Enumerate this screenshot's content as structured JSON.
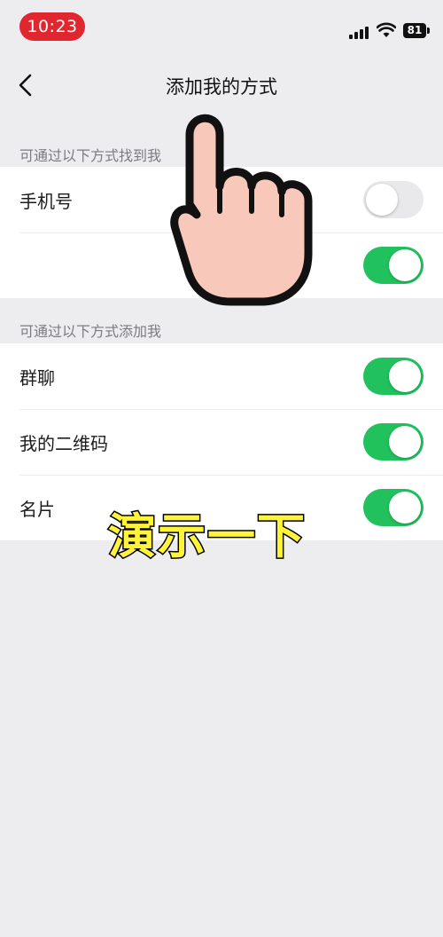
{
  "status_bar": {
    "time": "10:23",
    "battery": "81"
  },
  "nav": {
    "title": "添加我的方式"
  },
  "section_find": {
    "header": "可通过以下方式找到我",
    "items": [
      {
        "label": "手机号",
        "enabled": false
      },
      {
        "label": "",
        "enabled": true
      }
    ]
  },
  "section_add": {
    "header": "可通过以下方式添加我",
    "items": [
      {
        "label": "群聊",
        "enabled": true
      },
      {
        "label": "我的二维码",
        "enabled": true
      },
      {
        "label": "名片",
        "enabled": true
      }
    ]
  },
  "overlay": {
    "caption": "演示一下"
  },
  "colors": {
    "toggle_on": "#21c25e",
    "toggle_off": "#e9e9eb",
    "time_pill": "#e0262e",
    "caption": "#fff43a"
  }
}
